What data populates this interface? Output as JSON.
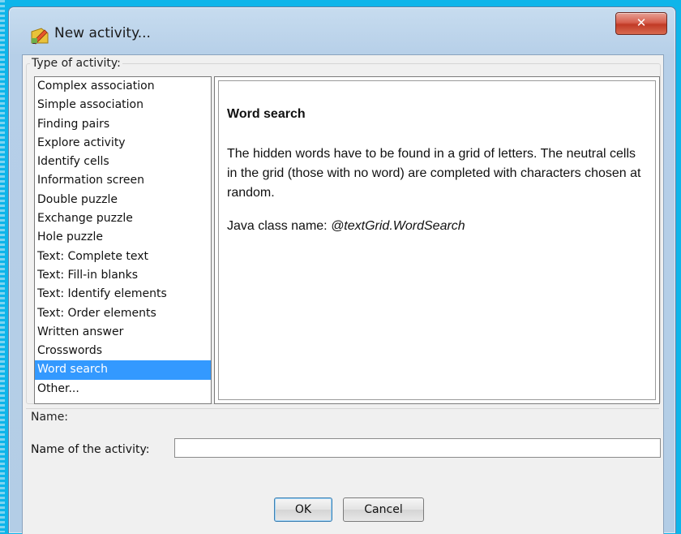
{
  "window": {
    "title": "New activity...",
    "close_label": "✕",
    "icon": "app-pencil-icon"
  },
  "type_group": {
    "legend": "Type of activity:",
    "items": [
      "Complex association",
      "Simple association",
      "Finding pairs",
      "Explore activity",
      "Identify cells",
      "Information screen",
      "Double puzzle",
      "Exchange puzzle",
      "Hole puzzle",
      "Text: Complete text",
      "Text: Fill-in blanks",
      "Text: Identify elements",
      "Text: Order elements",
      "Written answer",
      "Crosswords",
      "Word search",
      "Other..."
    ],
    "selected_item": "Word search"
  },
  "description": {
    "title": "Word search",
    "text": "The hidden words have to be found in a grid of letters. The neutral cells in the grid (those with no word) are completed with characters chosen at random.",
    "class_label": "Java class name: ",
    "class_value": "@textGrid.WordSearch"
  },
  "name_group": {
    "legend": "Name:",
    "field_label": "Name of the activity:",
    "field_value": ""
  },
  "buttons": {
    "ok": "OK",
    "cancel": "Cancel"
  },
  "colors": {
    "selection": "#3399ff",
    "backdrop": "#0eb5ea",
    "close_button": "#c94a34"
  }
}
